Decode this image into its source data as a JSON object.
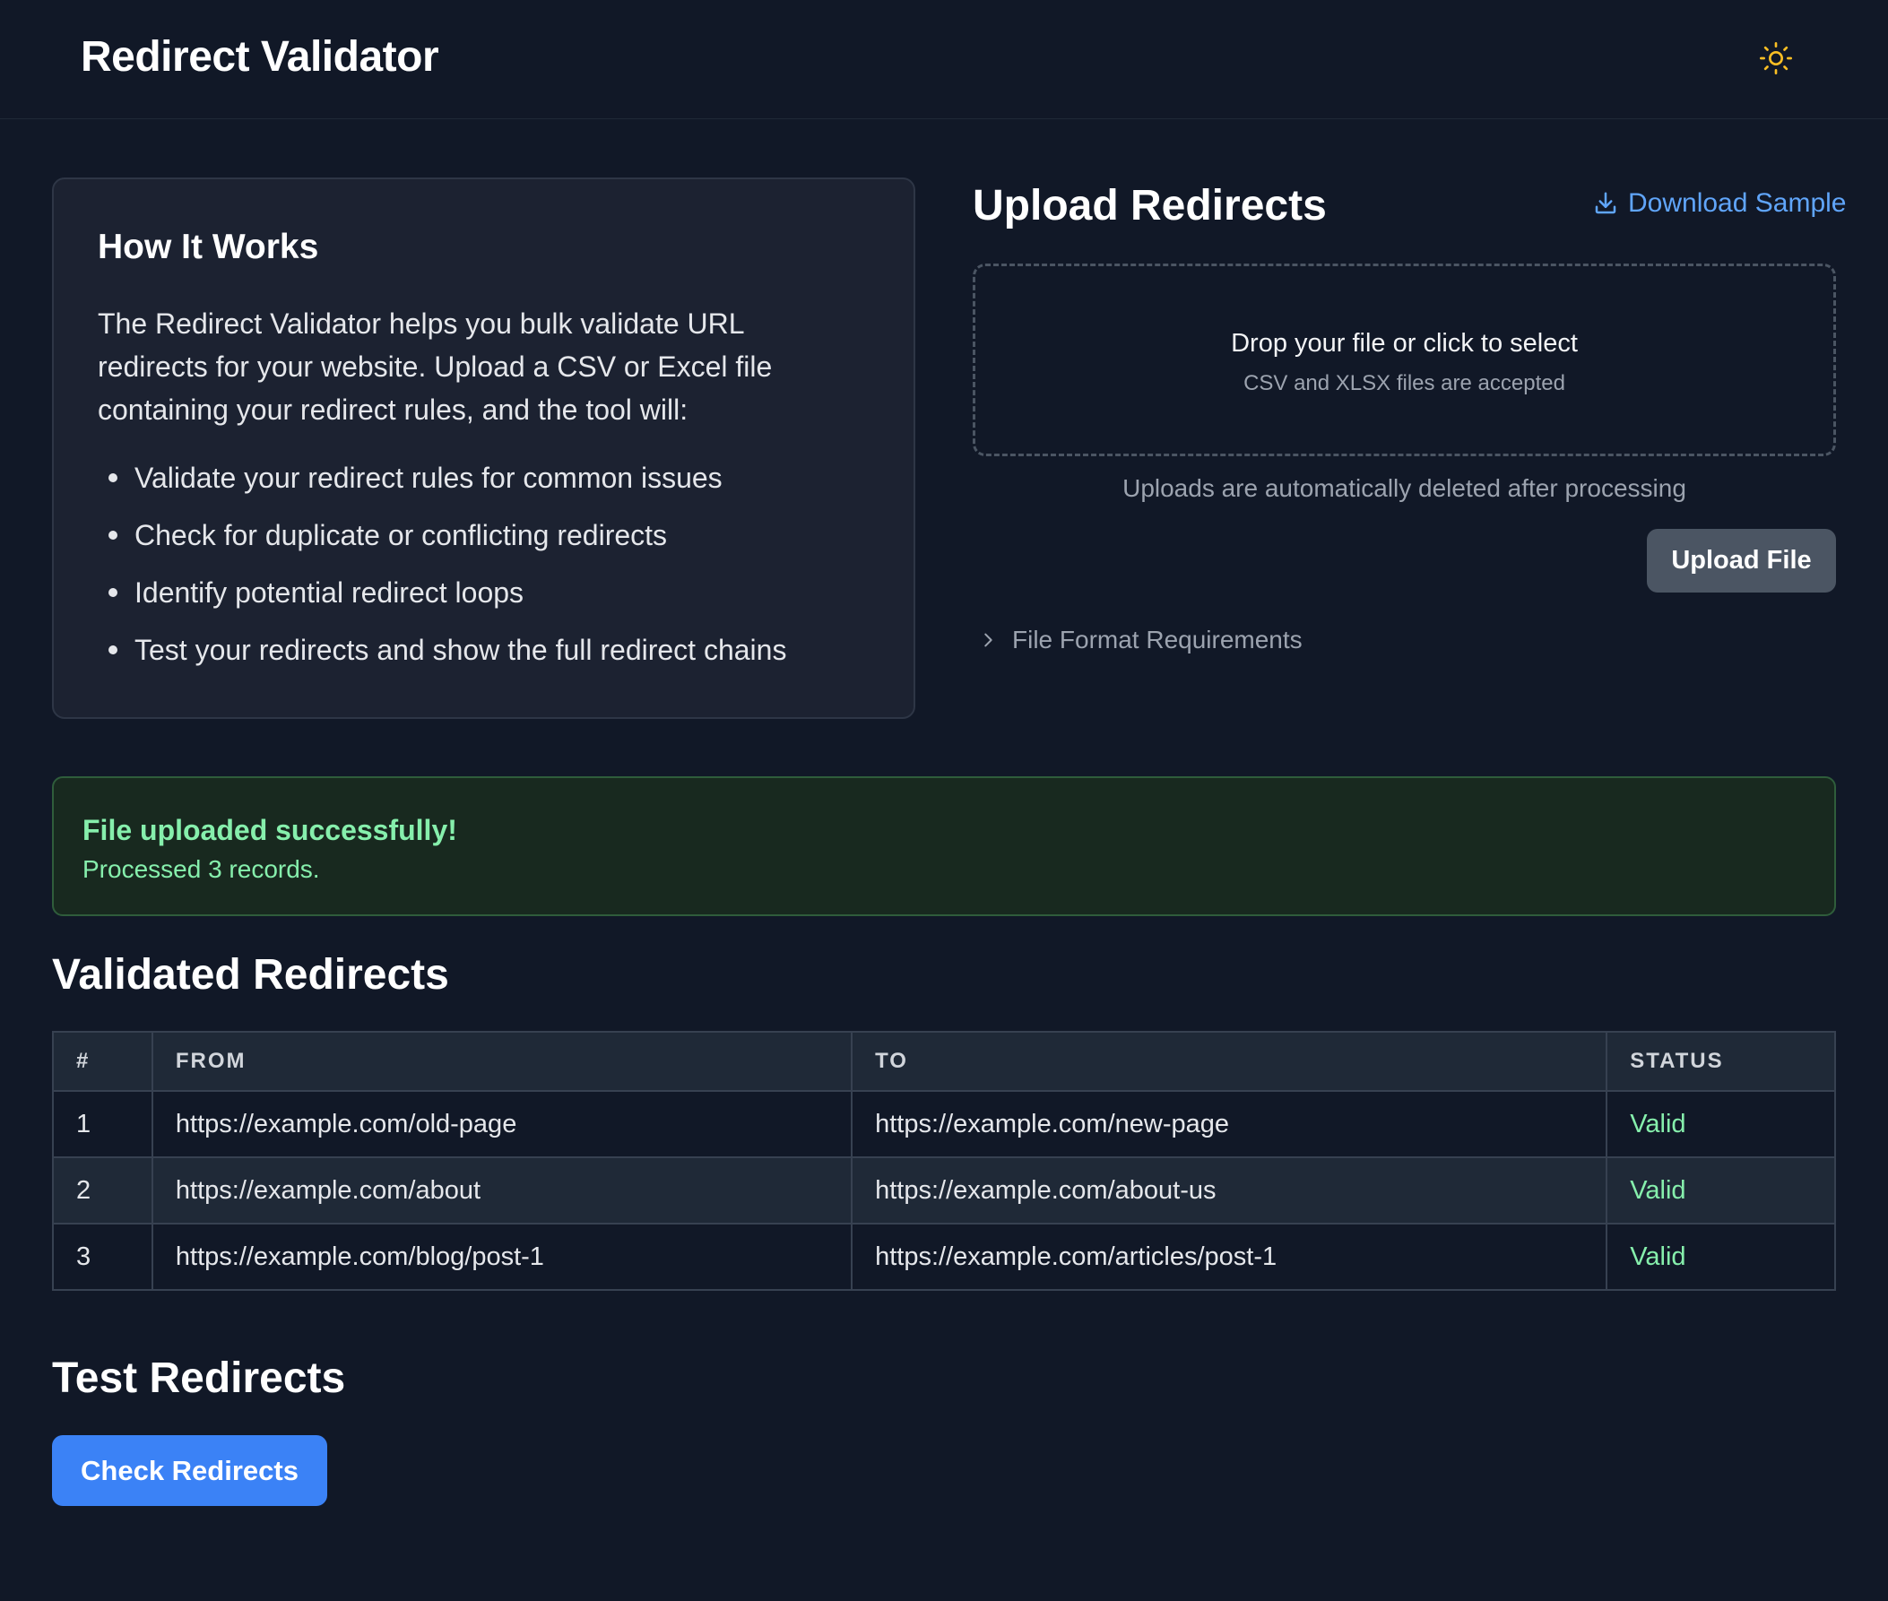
{
  "header": {
    "title": "Redirect Validator",
    "theme_toggle_icon": "sun-icon",
    "theme_icon_color": "#fbbf24"
  },
  "how_it_works": {
    "title": "How It Works",
    "description": "The Redirect Validator helps you bulk validate URL redirects for your website. Upload a CSV or Excel file containing your redirect rules, and the tool will:",
    "items": [
      "Validate your redirect rules for common issues",
      "Check for duplicate or conflicting redirects",
      "Identify potential redirect loops",
      "Test your redirects and show the full redirect chains"
    ]
  },
  "upload": {
    "title": "Upload Redirects",
    "download_label": "Download Sample",
    "download_icon": "download-icon",
    "dropzone_main": "Drop your file or click to select",
    "dropzone_sub": "CSV and XLSX files are accepted",
    "note": "Uploads are automatically deleted after processing",
    "button_label": "Upload File",
    "format_label": "File Format Requirements",
    "format_icon": "chevron-right-icon"
  },
  "success": {
    "title": "File uploaded successfully!",
    "detail": "Processed 3 records."
  },
  "validated": {
    "title": "Validated Redirects",
    "columns": [
      "#",
      "FROM",
      "TO",
      "STATUS"
    ],
    "rows": [
      {
        "num": "1",
        "from": "https://example.com/old-page",
        "to": "https://example.com/new-page",
        "status": "Valid"
      },
      {
        "num": "2",
        "from": "https://example.com/about",
        "to": "https://example.com/about-us",
        "status": "Valid"
      },
      {
        "num": "3",
        "from": "https://example.com/blog/post-1",
        "to": "https://example.com/articles/post-1",
        "status": "Valid"
      }
    ]
  },
  "test": {
    "title": "Test Redirects",
    "button_label": "Check Redirects"
  },
  "colors": {
    "background": "#111827",
    "accent": "#3b82f6",
    "link": "#60a5fa",
    "success": "#86efac"
  }
}
